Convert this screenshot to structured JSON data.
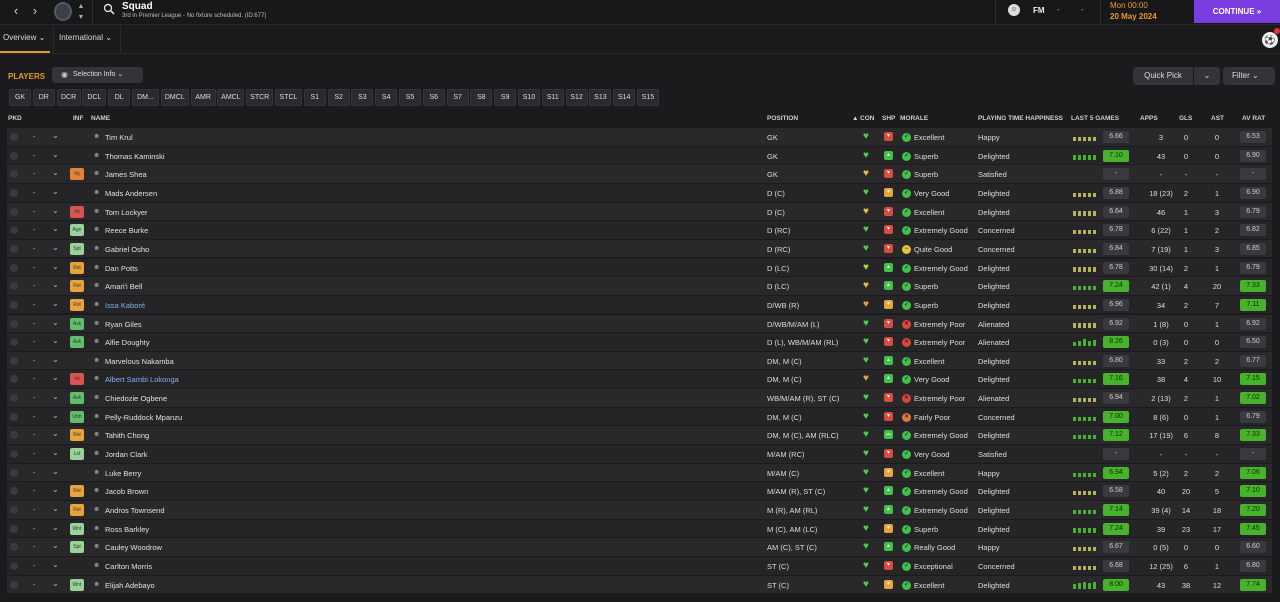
{
  "header": {
    "title": "Squad",
    "subtitle": "3rd in Premier League - No fixture scheduled. (ID:677)",
    "manager": "FM",
    "manager_dd1": "-",
    "manager_dd2": "-",
    "time": "Mon 00:00",
    "date": "20 May 2024",
    "continue_label": "CONTINUE"
  },
  "tabs": {
    "overview": "Overview",
    "international": "International"
  },
  "toolbar": {
    "players": "PLAYERS",
    "selection_info": "Selection Info",
    "quick_pick": "Quick Pick",
    "filter": "Filter"
  },
  "positions": [
    "GK",
    "DR",
    "DCR",
    "DCL",
    "DL",
    "DM...",
    "DMCL",
    "AMR",
    "AMCL",
    "STCR",
    "STCL",
    "S1",
    "S2",
    "S3",
    "S4",
    "S5",
    "S6",
    "S7",
    "S8",
    "S9",
    "S10",
    "S11",
    "S12",
    "S13",
    "S14",
    "S15"
  ],
  "columns": {
    "pkd": "PKD",
    "inf": "INF",
    "name": "NAME",
    "position": "POSITION",
    "con": "CON",
    "shp": "SHP",
    "morale": "MORALE",
    "pth": "PLAYING TIME HAPPINESS",
    "last5": "LAST 5 GAMES",
    "apps": "APPS",
    "gls": "GLS",
    "ast": "AST",
    "avrat": "AV RAT"
  },
  "colors": {
    "accent": "#e39b2d",
    "continue": "#7a3ee0",
    "good": "#48b22d",
    "link": "#7fb1ef"
  },
  "players": [
    {
      "inf": "",
      "inf_color": "",
      "name": "Tim Krul",
      "link": false,
      "pos": "GK",
      "con": "#46d04b",
      "shp": "#d94a3f",
      "shp_icon": "▾",
      "mor_color": "#3fc14a",
      "mor_icon": "✓",
      "morale": "Excellent",
      "pth": "Happy",
      "bars": [
        0.6,
        0.6,
        0.6,
        0.6,
        0.6
      ],
      "last5": "6.66",
      "l5good": false,
      "apps": "3",
      "gls": "0",
      "ast": "0",
      "avr": "6.53",
      "avrgood": false
    },
    {
      "inf": "",
      "inf_color": "",
      "name": "Thomas Kaminski",
      "link": false,
      "pos": "GK",
      "con": "#46d04b",
      "shp": "#3fc14a",
      "shp_icon": "▴",
      "mor_color": "#3fc14a",
      "mor_icon": "✓",
      "morale": "Superb",
      "pth": "Delighted",
      "bars": [
        0.6,
        0.6,
        0.6,
        0.6,
        0.6
      ],
      "last5": "7.10",
      "l5good": true,
      "apps": "43",
      "gls": "0",
      "ast": "0",
      "avr": "6.90",
      "avrgood": false
    },
    {
      "inf": "Inj",
      "inf_color": "#e3843a",
      "name": "James Shea",
      "link": false,
      "pos": "GK",
      "con": "#dcc433",
      "shp": "#d94a3f",
      "shp_icon": "▾",
      "mor_color": "#3fc14a",
      "mor_icon": "✓",
      "morale": "Superb",
      "pth": "Satisfied",
      "bars": [],
      "last5": "-",
      "l5good": false,
      "apps": "-",
      "gls": "-",
      "ast": "-",
      "avr": "-",
      "avrgood": false
    },
    {
      "inf": "",
      "inf_color": "",
      "name": "Mads Andersen",
      "link": false,
      "pos": "D (C)",
      "con": "#46d04b",
      "shp": "#e8a33a",
      "shp_icon": "▾",
      "mor_color": "#3fc14a",
      "mor_icon": "✓",
      "morale": "Very Good",
      "pth": "Delighted",
      "bars": [
        0.6,
        0.6,
        0.6,
        0.6,
        0.6
      ],
      "last5": "6.88",
      "l5good": false,
      "apps": "18 (23)",
      "gls": "2",
      "ast": "1",
      "avr": "6.90",
      "avrgood": false
    },
    {
      "inf": "Int",
      "inf_color": "#d9534f",
      "name": "Tom Lockyer",
      "link": false,
      "pos": "D (C)",
      "con": "#dcc433",
      "shp": "#d94a3f",
      "shp_icon": "▾",
      "mor_color": "#3fc14a",
      "mor_icon": "✓",
      "morale": "Excellent",
      "pth": "Delighted",
      "bars": [
        0.6,
        0.6,
        0.6,
        0.6,
        0.6
      ],
      "last5": "6.64",
      "l5good": false,
      "apps": "46",
      "gls": "1",
      "ast": "3",
      "avr": "6.79",
      "avrgood": false
    },
    {
      "inf": "Agn",
      "inf_color": "#9ad39a",
      "name": "Reece Burke",
      "link": false,
      "pos": "D (RC)",
      "con": "#46d04b",
      "shp": "#d94a3f",
      "shp_icon": "▾",
      "mor_color": "#3fc14a",
      "mor_icon": "✓",
      "morale": "Extremely Good",
      "pth": "Concerned",
      "bars": [
        0.6,
        0.6,
        0.6,
        0.6,
        0.6
      ],
      "last5": "6.78",
      "l5good": false,
      "apps": "6 (22)",
      "gls": "1",
      "ast": "2",
      "avr": "6.82",
      "avrgood": false
    },
    {
      "inf": "Spt",
      "inf_color": "#9ad39a",
      "name": "Gabriel Osho",
      "link": false,
      "pos": "D (RC)",
      "con": "#46d04b",
      "shp": "#d94a3f",
      "shp_icon": "▾",
      "mor_color": "#e8c23a",
      "mor_icon": "−",
      "morale": "Quite Good",
      "pth": "Concerned",
      "bars": [
        0.6,
        0.6,
        0.6,
        0.6,
        0.6
      ],
      "last5": "6.84",
      "l5good": false,
      "apps": "7 (19)",
      "gls": "1",
      "ast": "3",
      "avr": "6.85",
      "avrgood": false
    },
    {
      "inf": "Rst",
      "inf_color": "#e8a33a",
      "name": "Dan Potts",
      "link": false,
      "pos": "D (LC)",
      "con": "#9ed83b",
      "shp": "#3fc14a",
      "shp_icon": "▴",
      "mor_color": "#3fc14a",
      "mor_icon": "✓",
      "morale": "Extremely Good",
      "pth": "Delighted",
      "bars": [
        0.6,
        0.6,
        0.6,
        0.6,
        0.6
      ],
      "last5": "6.78",
      "l5good": false,
      "apps": "30 (14)",
      "gls": "2",
      "ast": "1",
      "avr": "6.79",
      "avrgood": false
    },
    {
      "inf": "Rst",
      "inf_color": "#e8a33a",
      "name": "Amari'i Bell",
      "link": false,
      "pos": "D (LC)",
      "con": "#dcc433",
      "shp": "#3fc14a",
      "shp_icon": "▴",
      "mor_color": "#3fc14a",
      "mor_icon": "✓",
      "morale": "Superb",
      "pth": "Delighted",
      "bars": [
        0.6,
        0.6,
        0.6,
        0.6,
        0.6
      ],
      "last5": "7.24",
      "l5good": true,
      "apps": "42 (1)",
      "gls": "4",
      "ast": "20",
      "avr": "7.33",
      "avrgood": true
    },
    {
      "inf": "Rst",
      "inf_color": "#e8a33a",
      "name": "Issa Kaboré",
      "link": true,
      "pos": "D/WB (R)",
      "con": "#e8a33a",
      "shp": "#e8a33a",
      "shp_icon": "▾",
      "mor_color": "#3fc14a",
      "mor_icon": "✓",
      "morale": "Superb",
      "pth": "Delighted",
      "bars": [
        0.6,
        0.6,
        0.6,
        0.6,
        0.6
      ],
      "last5": "6.96",
      "l5good": false,
      "apps": "34",
      "gls": "2",
      "ast": "7",
      "avr": "7.11",
      "avrgood": true
    },
    {
      "inf": "Ask",
      "inf_color": "#5fbf6a",
      "name": "Ryan Giles",
      "link": false,
      "pos": "D/WB/M/AM (L)",
      "con": "#46d04b",
      "shp": "#d94a3f",
      "shp_icon": "▾",
      "mor_color": "#e0453a",
      "mor_icon": "✕",
      "morale": "Extremely Poor",
      "pth": "Alienated",
      "bars": [
        0.6,
        0.6,
        0.6,
        0.6,
        0.6
      ],
      "last5": "6.92",
      "l5good": false,
      "apps": "1 (8)",
      "gls": "0",
      "ast": "1",
      "avr": "6.92",
      "avrgood": false
    },
    {
      "inf": "Ask",
      "inf_color": "#5fbf6a",
      "name": "Alfie Doughty",
      "link": false,
      "pos": "D (L), WB/M/AM (RL)",
      "con": "#46d04b",
      "shp": "#d94a3f",
      "shp_icon": "▾",
      "mor_color": "#e0453a",
      "mor_icon": "✕",
      "morale": "Extremely Poor",
      "pth": "Alienated",
      "bars": [
        0.6,
        0.8,
        1,
        0.8,
        0.9
      ],
      "last5": "8.26",
      "l5good": true,
      "apps": "0 (3)",
      "gls": "0",
      "ast": "0",
      "avr": "6.50",
      "avrgood": false
    },
    {
      "inf": "",
      "inf_color": "",
      "name": "Marvelous Nakamba",
      "link": false,
      "pos": "DM, M (C)",
      "con": "#46d04b",
      "shp": "#3fc14a",
      "shp_icon": "▴",
      "mor_color": "#3fc14a",
      "mor_icon": "✓",
      "morale": "Excellent",
      "pth": "Delighted",
      "bars": [
        0.6,
        0.6,
        0.6,
        0.6,
        0.6
      ],
      "last5": "6.80",
      "l5good": false,
      "apps": "33",
      "gls": "2",
      "ast": "2",
      "avr": "6.77",
      "avrgood": false
    },
    {
      "inf": "Int",
      "inf_color": "#d9534f",
      "name": "Albert Sambi Lokonga",
      "link": true,
      "pos": "DM, M (C)",
      "con": "#e8a33a",
      "shp": "#3fc14a",
      "shp_icon": "▴",
      "mor_color": "#3fc14a",
      "mor_icon": "✓",
      "morale": "Very Good",
      "pth": "Delighted",
      "bars": [
        0.6,
        0.6,
        0.6,
        0.6,
        0.6
      ],
      "last5": "7.16",
      "l5good": true,
      "apps": "38",
      "gls": "4",
      "ast": "10",
      "avr": "7.15",
      "avrgood": true
    },
    {
      "inf": "Ask",
      "inf_color": "#5fbf6a",
      "name": "Chiedozie Ogbene",
      "link": false,
      "pos": "WB/M/AM (R), ST (C)",
      "con": "#46d04b",
      "shp": "#d94a3f",
      "shp_icon": "▾",
      "mor_color": "#e0453a",
      "mor_icon": "✕",
      "morale": "Extremely Poor",
      "pth": "Alienated",
      "bars": [
        0.6,
        0.6,
        0.6,
        0.6,
        0.6
      ],
      "last5": "6.94",
      "l5good": false,
      "apps": "2 (13)",
      "gls": "2",
      "ast": "1",
      "avr": "7.02",
      "avrgood": true
    },
    {
      "inf": "Unh",
      "inf_color": "#5fbf6a",
      "name": "Pelly-Ruddock Mpanzu",
      "link": false,
      "pos": "DM, M (C)",
      "con": "#46d04b",
      "shp": "#d94a3f",
      "shp_icon": "▾",
      "mor_color": "#e07a3a",
      "mor_icon": "✕",
      "morale": "Fairly Poor",
      "pth": "Concerned",
      "bars": [
        0.6,
        0.6,
        0.6,
        0.6,
        0.6
      ],
      "last5": "7.00",
      "l5good": true,
      "apps": "8 (6)",
      "gls": "0",
      "ast": "1",
      "avr": "6.79",
      "avrgood": false
    },
    {
      "inf": "Rst",
      "inf_color": "#e8a33a",
      "name": "Tahith Chong",
      "link": false,
      "pos": "DM, M (C), AM (RLC)",
      "con": "#46d04b",
      "shp": "#3fc14a",
      "shp_icon": "︽",
      "mor_color": "#3fc14a",
      "mor_icon": "✓",
      "morale": "Extremely Good",
      "pth": "Delighted",
      "bars": [
        0.6,
        0.6,
        0.6,
        0.6,
        0.6
      ],
      "last5": "7.12",
      "l5good": true,
      "apps": "17 (19)",
      "gls": "6",
      "ast": "8",
      "avr": "7.33",
      "avrgood": true
    },
    {
      "inf": "Lst",
      "inf_color": "#9ad39a",
      "name": "Jordan Clark",
      "link": false,
      "pos": "M/AM (RC)",
      "con": "#46d04b",
      "shp": "#d94a3f",
      "shp_icon": "▾",
      "mor_color": "#3fc14a",
      "mor_icon": "✓",
      "morale": "Very Good",
      "pth": "Satisfied",
      "bars": [],
      "last5": "-",
      "l5good": false,
      "apps": "-",
      "gls": "-",
      "ast": "-",
      "avr": "-",
      "avrgood": false
    },
    {
      "inf": "",
      "inf_color": "",
      "name": "Luke Berry",
      "link": false,
      "pos": "M/AM (C)",
      "con": "#46d04b",
      "shp": "#e8a33a",
      "shp_icon": "▾",
      "mor_color": "#3fc14a",
      "mor_icon": "✓",
      "morale": "Excellent",
      "pth": "Happy",
      "bars": [
        0.6,
        0.6,
        0.6,
        0.6,
        0.6
      ],
      "last5": "6.94",
      "l5good": true,
      "apps": "5 (2)",
      "gls": "2",
      "ast": "2",
      "avr": "7.06",
      "avrgood": true
    },
    {
      "inf": "Rst",
      "inf_color": "#e8a33a",
      "name": "Jacob Brown",
      "link": false,
      "pos": "M/AM (R), ST (C)",
      "con": "#46d04b",
      "shp": "#3fc14a",
      "shp_icon": "▴",
      "mor_color": "#3fc14a",
      "mor_icon": "✓",
      "morale": "Extremely Good",
      "pth": "Delighted",
      "bars": [
        0.6,
        0.6,
        0.6,
        0.6,
        0.6
      ],
      "last5": "6.58",
      "l5good": false,
      "apps": "40",
      "gls": "20",
      "ast": "5",
      "avr": "7.10",
      "avrgood": true
    },
    {
      "inf": "Rst",
      "inf_color": "#e8a33a",
      "name": "Andros Townsend",
      "link": false,
      "pos": "M (R), AM (RL)",
      "con": "#46d04b",
      "shp": "#3fc14a",
      "shp_icon": "▴",
      "mor_color": "#3fc14a",
      "mor_icon": "✓",
      "morale": "Extremely Good",
      "pth": "Delighted",
      "bars": [
        0.6,
        0.6,
        0.6,
        0.6,
        0.6
      ],
      "last5": "7.14",
      "l5good": true,
      "apps": "39 (4)",
      "gls": "14",
      "ast": "18",
      "avr": "7.20",
      "avrgood": true
    },
    {
      "inf": "Wnt",
      "inf_color": "#9ad39a",
      "name": "Ross Barkley",
      "link": false,
      "pos": "M (C), AM (LC)",
      "con": "#46d04b",
      "shp": "#e8a33a",
      "shp_icon": "▾",
      "mor_color": "#3fc14a",
      "mor_icon": "✓",
      "morale": "Superb",
      "pth": "Delighted",
      "bars": [
        0.6,
        0.6,
        0.6,
        0.6,
        0.6
      ],
      "last5": "7.24",
      "l5good": true,
      "apps": "39",
      "gls": "23",
      "ast": "17",
      "avr": "7.45",
      "avrgood": true
    },
    {
      "inf": "Spt",
      "inf_color": "#9ad39a",
      "name": "Cauley Woodrow",
      "link": false,
      "pos": "AM (C), ST (C)",
      "con": "#46d04b",
      "shp": "#3fc14a",
      "shp_icon": "▴",
      "mor_color": "#3fc14a",
      "mor_icon": "✓",
      "morale": "Really Good",
      "pth": "Happy",
      "bars": [
        0.6,
        0.6,
        0.6,
        0.6,
        0.6
      ],
      "last5": "6.67",
      "l5good": false,
      "apps": "0 (5)",
      "gls": "0",
      "ast": "0",
      "avr": "6.60",
      "avrgood": false
    },
    {
      "inf": "",
      "inf_color": "",
      "name": "Carlton Morris",
      "link": false,
      "pos": "ST (C)",
      "con": "#46d04b",
      "shp": "#d94a3f",
      "shp_icon": "▾",
      "mor_color": "#3fc14a",
      "mor_icon": "✓",
      "morale": "Exceptional",
      "pth": "Concerned",
      "bars": [
        0.6,
        0.6,
        0.6,
        0.6,
        0.6
      ],
      "last5": "6.68",
      "l5good": false,
      "apps": "12 (25)",
      "gls": "6",
      "ast": "1",
      "avr": "6.80",
      "avrgood": false
    },
    {
      "inf": "Wnt",
      "inf_color": "#9ad39a",
      "name": "Elijah Adebayo",
      "link": false,
      "pos": "ST (C)",
      "con": "#46d04b",
      "shp": "#e8a33a",
      "shp_icon": "▾",
      "mor_color": "#3fc14a",
      "mor_icon": "✓",
      "morale": "Excellent",
      "pth": "Delighted",
      "bars": [
        0.6,
        0.8,
        1,
        0.8,
        0.9
      ],
      "last5": "8.00",
      "l5good": true,
      "apps": "43",
      "gls": "38",
      "ast": "12",
      "avr": "7.74",
      "avrgood": true
    }
  ]
}
